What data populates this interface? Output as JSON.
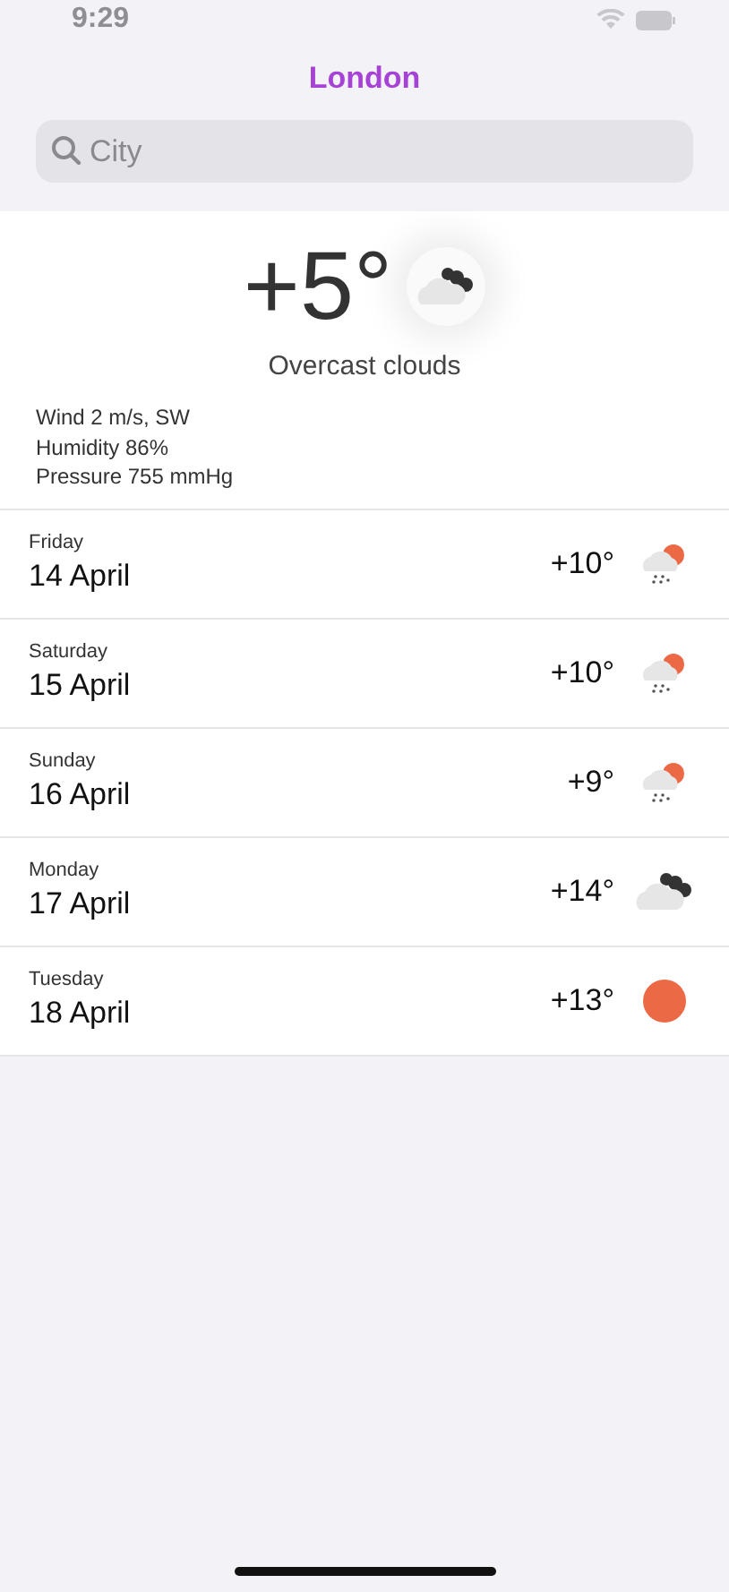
{
  "status_bar": {
    "time": "9:29"
  },
  "title": "London",
  "search": {
    "placeholder": "City"
  },
  "current": {
    "temperature": "+5°",
    "kind": "clouds",
    "description": "Overcast clouds",
    "details": [
      "Wind 2 m/s, SW",
      "Humidity 86%",
      "Pressure 755 mmHg"
    ]
  },
  "forecast": [
    {
      "weekday": "Friday",
      "date": "14 April",
      "temperature": "+10°",
      "kind": "rain"
    },
    {
      "weekday": "Saturday",
      "date": "15 April",
      "temperature": "+10°",
      "kind": "rain"
    },
    {
      "weekday": "Sunday",
      "date": "16 April",
      "temperature": "+9°",
      "kind": "rain"
    },
    {
      "weekday": "Monday",
      "date": "17 April",
      "temperature": "+14°",
      "kind": "clouds"
    },
    {
      "weekday": "Tuesday",
      "date": "18 April",
      "temperature": "+13°",
      "kind": "sun"
    }
  ]
}
